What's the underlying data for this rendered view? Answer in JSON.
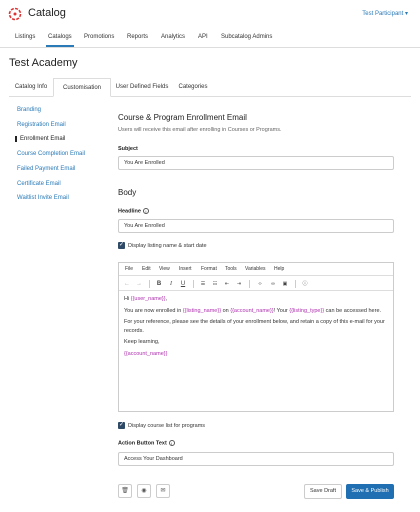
{
  "app": {
    "title": "Catalog",
    "user": "Test Participant ▾"
  },
  "mainnav": [
    "Listings",
    "Catalogs",
    "Promotions",
    "Reports",
    "Analytics",
    "API",
    "Subcatalog Admins"
  ],
  "page_title": "Test Academy",
  "subtabs": [
    "Catalog Info",
    "Customisation",
    "User Defined Fields",
    "Categories"
  ],
  "sidenav": [
    "Branding",
    "Registration Email",
    "Enrollment Email",
    "Course Completion Email",
    "Failed Payment Email",
    "Certificate Email",
    "Waitlist Invite Email"
  ],
  "content": {
    "heading": "Course & Program Enrollment Email",
    "description": "Users will receive this email after enrolling in Courses or Programs.",
    "subject_label": "Subject",
    "subject_value": "You Are Enrolled",
    "body_heading": "Body",
    "headline_label": "Headline",
    "headline_value": "You Are Enrolled",
    "display_listing_label": "Display listing name & start date",
    "display_courses_label": "Display course list for programs",
    "action_label": "Action Button Text",
    "action_value": "Access Your Dashboard"
  },
  "editor": {
    "menus": [
      "File",
      "Edit",
      "View",
      "Insert",
      "Format",
      "Tools",
      "Variables",
      "Help"
    ],
    "greeting_prefix": "Hi ",
    "greeting_var": "{{user_name}}",
    "greeting_suffix": ",",
    "line2_a": "You are now enrolled in ",
    "line2_var1": "{{listing_name}}",
    "line2_b": " on ",
    "line2_var2": "{{account_name}}",
    "line2_c": "! Your ",
    "line2_var3": "{{listing_type}}",
    "line2_d": " can be accessed here.",
    "line3": "For your reference, please see the details of your enrollment below, and retain a copy of this e-mail for your records.",
    "line4": "Keep learning,",
    "signature_var": "{{account_name}}"
  },
  "footer": {
    "draft": "Save Draft",
    "publish": "Save & Publish"
  }
}
